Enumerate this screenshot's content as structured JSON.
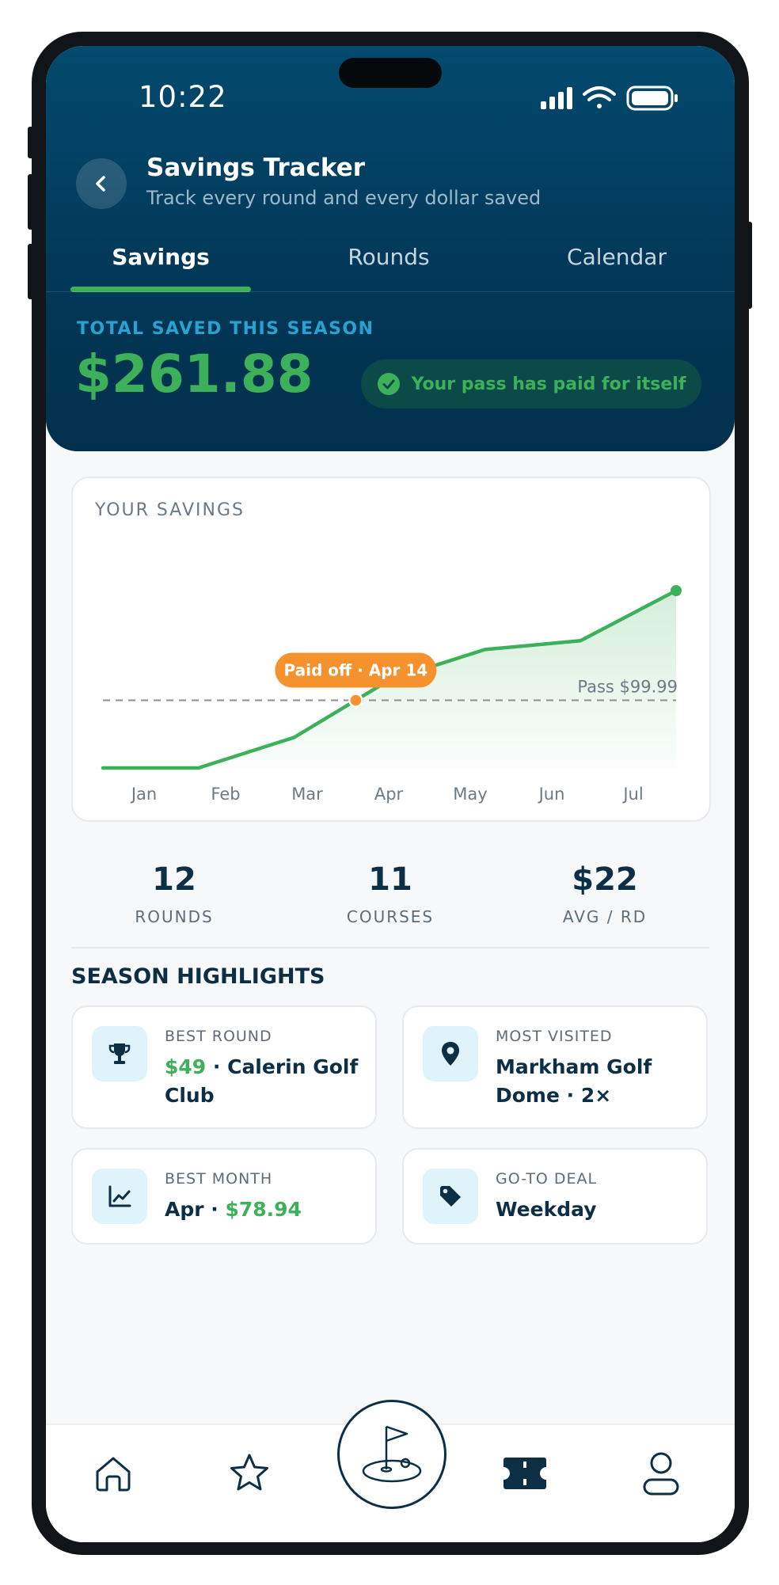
{
  "status": {
    "time": "10:22"
  },
  "header": {
    "title": "Savings Tracker",
    "subtitle": "Track every round and every dollar saved"
  },
  "tabs": [
    {
      "label": "Savings",
      "active": true
    },
    {
      "label": "Rounds",
      "active": false
    },
    {
      "label": "Calendar",
      "active": false
    }
  ],
  "summary": {
    "total_label": "TOTAL SAVED THIS SEASON",
    "total_value": "$261.88",
    "paid_badge": "Your pass has paid for itself"
  },
  "chart": {
    "title": "YOUR SAVINGS"
  },
  "chart_data": {
    "type": "line",
    "x": [
      "Jan",
      "Feb",
      "Mar",
      "Apr",
      "May",
      "Jun",
      "Jul"
    ],
    "series": [
      {
        "values": [
          0,
          0,
          45,
          130,
          175,
          188,
          262
        ]
      }
    ],
    "reference_line": {
      "label": "Pass $99.99",
      "value": 99.99
    },
    "annotation": {
      "label": "Paid off · Apr 14",
      "x": "Apr"
    },
    "ylim": [
      0,
      262
    ],
    "colors": {
      "line": "#3db05a",
      "marker": "#f5922e",
      "reference": "#8a8f94"
    }
  },
  "stats": [
    {
      "value": "12",
      "label": "ROUNDS"
    },
    {
      "value": "11",
      "label": "COURSES"
    },
    {
      "value": "$22",
      "label": "AVG / RD"
    }
  ],
  "highlights": {
    "title": "SEASON HIGHLIGHTS",
    "best_round": {
      "label": "BEST ROUND",
      "amount": "$49",
      "rest": " · Calerin Golf Club",
      "icon": "trophy-icon"
    },
    "most_visited": {
      "label": "MOST VISITED",
      "value": "Markham Golf Dome · 2×",
      "icon": "map-pin-icon"
    },
    "best_month": {
      "label": "BEST MONTH",
      "month": "Apr · ",
      "amount": "$78.94",
      "icon": "trending-up-icon"
    },
    "go_to_deal": {
      "label": "GO-TO DEAL",
      "value": "Weekday",
      "icon": "tag-icon"
    }
  },
  "nav": {
    "items": [
      "home-icon",
      "star-icon",
      "golf-flag-icon",
      "ticket-icon",
      "profile-icon"
    ]
  },
  "colors": {
    "brand_dark": "#023858",
    "accent_green": "#3db05a",
    "accent_orange": "#f5922e",
    "accent_blue": "#27a3d1"
  }
}
